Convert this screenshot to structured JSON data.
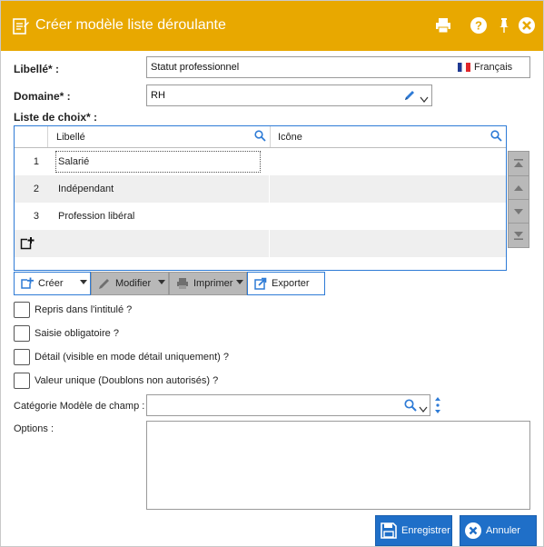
{
  "window": {
    "title": "Créer modèle liste déroulante"
  },
  "form": {
    "libelle_label": "Libellé* :",
    "libelle_value": "Statut professionnel",
    "language": "Français",
    "domaine_label": "Domaine* :",
    "domaine_value": "RH",
    "liste_label": "Liste de choix* :"
  },
  "grid": {
    "columns": [
      "Libellé",
      "Icône"
    ],
    "rows": [
      {
        "num": "1",
        "label": "Salarié"
      },
      {
        "num": "2",
        "label": "Indépendant"
      },
      {
        "num": "3",
        "label": "Profession libéral"
      }
    ]
  },
  "toolbar": {
    "creer": "Créer",
    "modifier": "Modifier",
    "imprimer": "Imprimer",
    "exporter": "Exporter"
  },
  "checkboxes": [
    {
      "label": "Repris dans l'intitulé ?",
      "checked": false
    },
    {
      "label": "Saisie obligatoire ?",
      "checked": false
    },
    {
      "label": "Détail (visible en mode détail uniquement) ?",
      "checked": false
    },
    {
      "label": "Valeur unique (Doublons non autorisés) ?",
      "checked": false
    }
  ],
  "categorie": {
    "label": "Catégorie Modèle de champ :",
    "value": ""
  },
  "options": {
    "label": "Options :",
    "value": ""
  },
  "actions": {
    "save": "Enregistrer",
    "cancel": "Annuler"
  },
  "colors": {
    "titlebar": "#e8a800",
    "primary": "#1f6fc8",
    "grid_border": "#2e7bd6"
  }
}
